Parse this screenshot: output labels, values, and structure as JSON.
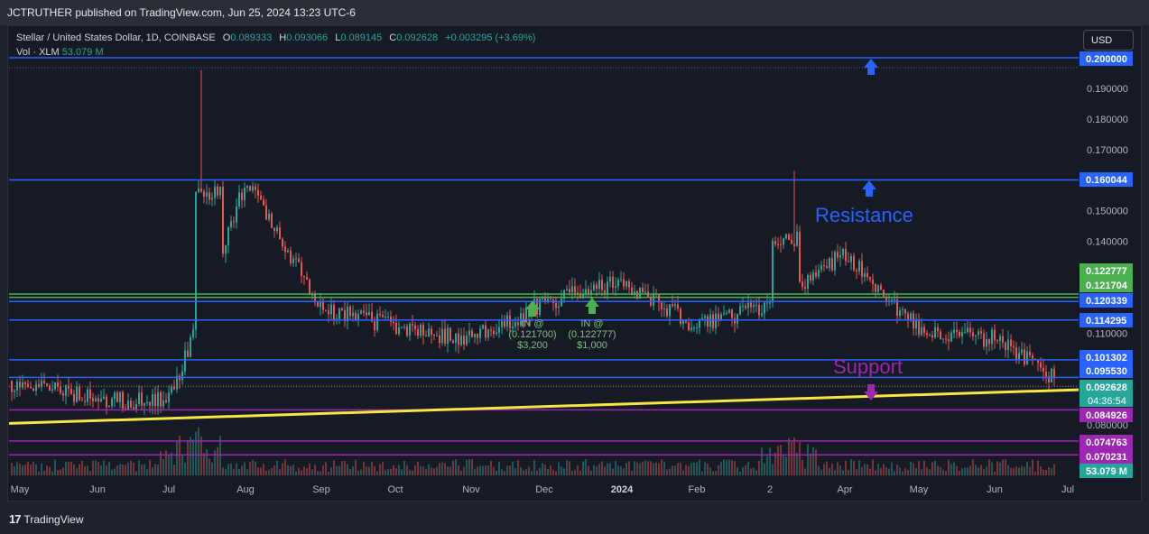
{
  "header": {
    "publisher": "JCTRUTHER published on TradingView.com, Jun 25, 2024 13:23 UTC-6"
  },
  "legend": {
    "symbol": "Stellar / United States Dollar, 1D, COINBASE",
    "o_label": "O",
    "o_value": "0.089333",
    "h_label": "H",
    "h_value": "0.093066",
    "l_label": "L",
    "l_value": "0.089145",
    "c_label": "C",
    "c_value": "0.092628",
    "change": "+0.003295 (+3.69%)",
    "vol_label": "Vol · XLM",
    "vol_value": "53.079 M"
  },
  "toolbar": {
    "currency": "USD"
  },
  "footer": {
    "brand": "TradingView"
  },
  "colors": {
    "up": "#26a69a",
    "down": "#ef5350",
    "blue_level": "#2962ff",
    "green_level": "#4caf50",
    "purple_level": "#9c27b0",
    "trendline": "#f5e642"
  },
  "chart_data": {
    "type": "candlestick",
    "x_ticks": [
      "May",
      "Jun",
      "Jul",
      "Aug",
      "Sep",
      "Oct",
      "Nov",
      "Dec",
      "2024",
      "Feb",
      "2",
      "Apr",
      "May",
      "Jun",
      "Jul"
    ],
    "y_ticks": [
      "0.200000",
      "0.190000",
      "0.180000",
      "0.170000",
      "0.160000",
      "0.150000",
      "0.140000",
      "0.130000",
      "0.120000",
      "0.110000",
      "0.100000",
      "0.090000",
      "0.080000",
      "0.070000"
    ],
    "ylim": [
      0.066,
      0.201
    ],
    "horizontal_levels": [
      {
        "value": 0.2,
        "label": "0.200000",
        "color": "#2962ff"
      },
      {
        "value": 0.160044,
        "label": "0.160044",
        "color": "#2962ff"
      },
      {
        "value": 0.122777,
        "label": "0.122777",
        "color": "#4caf50"
      },
      {
        "value": 0.121704,
        "label": "0.121704",
        "color": "#4caf50"
      },
      {
        "value": 0.120339,
        "label": "0.120339",
        "color": "#2962ff"
      },
      {
        "value": 0.114295,
        "label": "0.114295",
        "color": "#2962ff"
      },
      {
        "value": 0.101302,
        "label": "0.101302",
        "color": "#2962ff"
      },
      {
        "value": 0.09553,
        "label": "0.095530",
        "color": "#2962ff"
      },
      {
        "value": 0.084926,
        "label": "0.084926",
        "color": "#9c27b0"
      },
      {
        "value": 0.074763,
        "label": "0.074763",
        "color": "#9c27b0"
      },
      {
        "value": 0.070231,
        "label": "0.070231",
        "color": "#9c27b0"
      }
    ],
    "current_price": {
      "label": "0.092628",
      "countdown": "04:36:54"
    },
    "volume_badge": "53.079 M",
    "trendline": {
      "from": [
        "May",
        0.0805
      ],
      "to": [
        "Jul",
        0.0915
      ]
    },
    "annotations": [
      {
        "text": "Resistance",
        "color": "#2962ff"
      },
      {
        "text": "Support",
        "color": "#9c27b0"
      },
      {
        "text": "IN @",
        "sub": "(0.121700)",
        "amount": "$3,200"
      },
      {
        "text": "IN @",
        "sub": "(0.122777)",
        "amount": "$1,000"
      }
    ],
    "series": [
      {
        "name": "XLM/USD",
        "x": [
          "May",
          "Jun",
          "Jul",
          "Aug",
          "Sep",
          "Oct",
          "Nov",
          "Dec",
          "2024",
          "Feb",
          "2",
          "Apr",
          "May",
          "Jun",
          "Jul"
        ],
        "values": [
          0.094,
          0.088,
          0.095,
          0.15,
          0.122,
          0.108,
          0.117,
          0.121,
          0.119,
          0.112,
          0.136,
          0.127,
          0.108,
          0.103,
          0.0926
        ]
      }
    ],
    "ohlc_monthly": [
      {
        "x": "May",
        "o": 0.0945,
        "h": 0.0965,
        "l": 0.0875,
        "c": 0.088
      },
      {
        "x": "Jun",
        "o": 0.088,
        "h": 0.092,
        "l": 0.08,
        "c": 0.088
      },
      {
        "x": "Jul",
        "o": 0.088,
        "h": 0.196,
        "l": 0.086,
        "c": 0.16
      },
      {
        "x": "Aug",
        "o": 0.16,
        "h": 0.172,
        "l": 0.112,
        "c": 0.118
      },
      {
        "x": "Sep",
        "o": 0.118,
        "h": 0.135,
        "l": 0.11,
        "c": 0.112
      },
      {
        "x": "Oct",
        "o": 0.112,
        "h": 0.113,
        "l": 0.101,
        "c": 0.108
      },
      {
        "x": "Nov",
        "o": 0.108,
        "h": 0.128,
        "l": 0.105,
        "c": 0.12
      },
      {
        "x": "Dec",
        "o": 0.12,
        "h": 0.137,
        "l": 0.115,
        "c": 0.127
      },
      {
        "x": "2024",
        "o": 0.127,
        "h": 0.136,
        "l": 0.111,
        "c": 0.112
      },
      {
        "x": "Feb",
        "o": 0.112,
        "h": 0.12,
        "l": 0.106,
        "c": 0.12
      },
      {
        "x": "2",
        "o": 0.12,
        "h": 0.163,
        "l": 0.118,
        "c": 0.136
      },
      {
        "x": "Apr",
        "o": 0.136,
        "h": 0.144,
        "l": 0.097,
        "c": 0.111
      },
      {
        "x": "May",
        "o": 0.111,
        "h": 0.118,
        "l": 0.101,
        "c": 0.108
      },
      {
        "x": "Jun",
        "o": 0.108,
        "h": 0.11,
        "l": 0.088,
        "c": 0.0926
      }
    ]
  }
}
